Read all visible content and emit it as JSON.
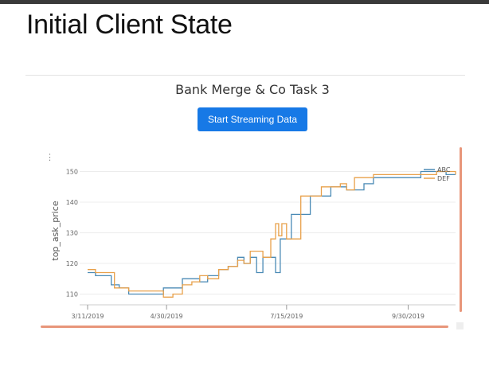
{
  "slide": {
    "title": "Initial Client State"
  },
  "app": {
    "title": "Bank Merge & Co Task 3",
    "button_label": "Start Streaming Data",
    "handle_icon": "vertical-dots-icon"
  },
  "colors": {
    "button": "#1779e6",
    "abc": "#4a8ab5",
    "def": "#e8a04a",
    "scrollbar": "#e8967a"
  },
  "chart_data": {
    "type": "line",
    "title": "",
    "xlabel": "",
    "ylabel": "top_ask_price",
    "ylim": [
      107,
      153
    ],
    "yticks": [
      110,
      120,
      130,
      140,
      150
    ],
    "xticks": [
      "3/11/2019",
      "4/30/2019",
      "7/15/2019",
      "9/30/2019"
    ],
    "legend_position": "top-right",
    "grid": "horizontal",
    "series": [
      {
        "name": "ABC",
        "points": [
          [
            "3/11/2019",
            117
          ],
          [
            "3/16/2019",
            116
          ],
          [
            "3/22/2019",
            116
          ],
          [
            "3/26/2019",
            113
          ],
          [
            "3/31/2019",
            112
          ],
          [
            "4/6/2019",
            110
          ],
          [
            "4/15/2019",
            110
          ],
          [
            "4/24/2019",
            110
          ],
          [
            "4/28/2019",
            112
          ],
          [
            "5/4/2019",
            112
          ],
          [
            "5/10/2019",
            115
          ],
          [
            "5/16/2019",
            115
          ],
          [
            "5/21/2019",
            114
          ],
          [
            "5/26/2019",
            116
          ],
          [
            "6/2/2019",
            118
          ],
          [
            "6/8/2019",
            119
          ],
          [
            "6/14/2019",
            122
          ],
          [
            "6/18/2019",
            120
          ],
          [
            "6/22/2019",
            122
          ],
          [
            "6/26/2019",
            117
          ],
          [
            "6/30/2019",
            122
          ],
          [
            "7/5/2019",
            122
          ],
          [
            "7/8/2019",
            117
          ],
          [
            "7/11/2019",
            128
          ],
          [
            "7/14/2019",
            128
          ],
          [
            "7/18/2019",
            136
          ],
          [
            "7/24/2019",
            136
          ],
          [
            "7/30/2019",
            142
          ],
          [
            "8/6/2019",
            142
          ],
          [
            "8/12/2019",
            145
          ],
          [
            "8/18/2019",
            145
          ],
          [
            "8/22/2019",
            144
          ],
          [
            "8/27/2019",
            144
          ],
          [
            "9/2/2019",
            146
          ],
          [
            "9/8/2019",
            148
          ],
          [
            "9/14/2019",
            148
          ],
          [
            "9/22/2019",
            148
          ],
          [
            "9/30/2019",
            148
          ],
          [
            "10/8/2019",
            150
          ],
          [
            "10/18/2019",
            150
          ],
          [
            "10/24/2019",
            149
          ],
          [
            "10/30/2019",
            149
          ]
        ]
      },
      {
        "name": "DEF",
        "points": [
          [
            "3/11/2019",
            118
          ],
          [
            "3/16/2019",
            117
          ],
          [
            "3/22/2019",
            117
          ],
          [
            "3/28/2019",
            112
          ],
          [
            "4/6/2019",
            111
          ],
          [
            "4/15/2019",
            111
          ],
          [
            "4/24/2019",
            111
          ],
          [
            "4/28/2019",
            109
          ],
          [
            "5/4/2019",
            110
          ],
          [
            "5/10/2019",
            113
          ],
          [
            "5/16/2019",
            114
          ],
          [
            "5/21/2019",
            116
          ],
          [
            "5/26/2019",
            115
          ],
          [
            "6/2/2019",
            118
          ],
          [
            "6/8/2019",
            119
          ],
          [
            "6/14/2019",
            121
          ],
          [
            "6/18/2019",
            120
          ],
          [
            "6/22/2019",
            124
          ],
          [
            "6/30/2019",
            122
          ],
          [
            "7/5/2019",
            128
          ],
          [
            "7/8/2019",
            133
          ],
          [
            "7/10/2019",
            129
          ],
          [
            "7/12/2019",
            133
          ],
          [
            "7/15/2019",
            128
          ],
          [
            "7/20/2019",
            128
          ],
          [
            "7/24/2019",
            142
          ],
          [
            "7/30/2019",
            142
          ],
          [
            "8/6/2019",
            145
          ],
          [
            "8/12/2019",
            145
          ],
          [
            "8/18/2019",
            146
          ],
          [
            "8/22/2019",
            144
          ],
          [
            "8/27/2019",
            148
          ],
          [
            "9/2/2019",
            148
          ],
          [
            "9/8/2019",
            149
          ],
          [
            "9/14/2019",
            149
          ],
          [
            "9/22/2019",
            149
          ],
          [
            "9/30/2019",
            149
          ],
          [
            "10/8/2019",
            149
          ],
          [
            "10/18/2019",
            150
          ],
          [
            "10/24/2019",
            150
          ],
          [
            "10/30/2019",
            149
          ]
        ]
      }
    ]
  }
}
